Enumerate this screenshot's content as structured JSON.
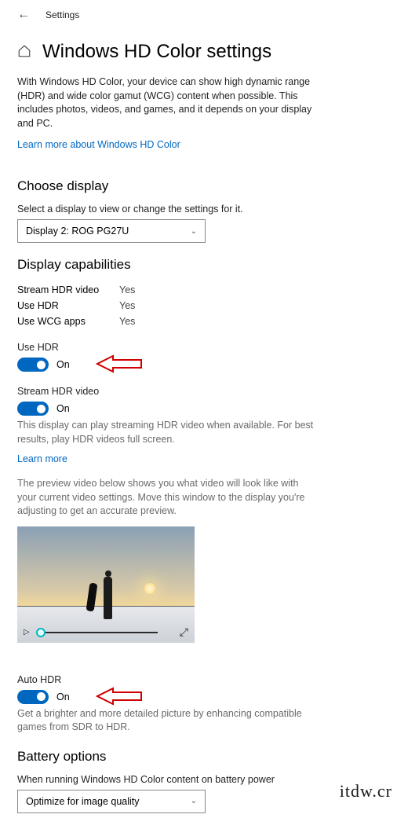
{
  "topbar": {
    "title": "Settings"
  },
  "page": {
    "title": "Windows HD Color settings",
    "description": "With Windows HD Color, your device can show high dynamic range (HDR) and wide color gamut (WCG) content when possible. This includes photos, videos, and games, and it depends on your display and PC.",
    "learn_more": "Learn more about Windows HD Color"
  },
  "choose_display": {
    "heading": "Choose display",
    "label": "Select a display to view or change the settings for it.",
    "selected": "Display 2: ROG PG27U"
  },
  "capabilities": {
    "heading": "Display capabilities",
    "rows": [
      {
        "label": "Stream HDR video",
        "value": "Yes"
      },
      {
        "label": "Use HDR",
        "value": "Yes"
      },
      {
        "label": "Use WCG apps",
        "value": "Yes"
      }
    ]
  },
  "use_hdr": {
    "title": "Use HDR",
    "state": "On"
  },
  "stream_hdr": {
    "title": "Stream HDR video",
    "state": "On",
    "desc": "This display can play streaming HDR video when available. For best results, play HDR videos full screen.",
    "learn_more": "Learn more",
    "preview_desc": "The preview video below shows you what video will look like with your current video settings. Move this window to the display you're adjusting to get an accurate preview."
  },
  "auto_hdr": {
    "title": "Auto HDR",
    "state": "On",
    "desc": "Get a brighter and more detailed picture by enhancing compatible games from SDR to HDR."
  },
  "battery": {
    "heading": "Battery options",
    "label": "When running Windows HD Color content on battery power",
    "selected": "Optimize for image quality"
  },
  "watermark": "itdw.cr"
}
